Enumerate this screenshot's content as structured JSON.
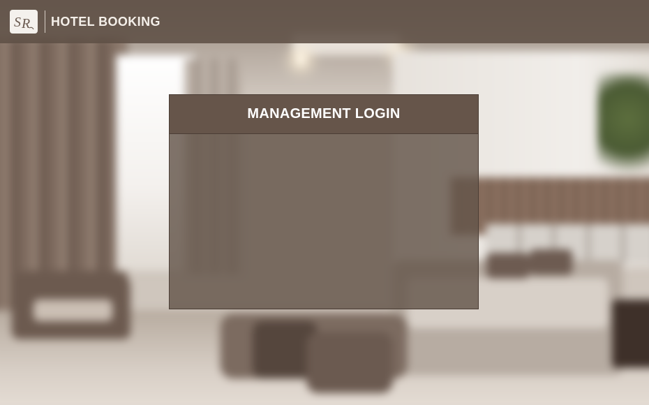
{
  "header": {
    "logo_text": "SR",
    "brand": "HOTEL BOOKING"
  },
  "login_panel": {
    "title": "MANAGEMENT LOGIN"
  },
  "colors": {
    "header_bg": "#5f5046",
    "panel_bg": "#64554b",
    "panel_head_bg": "#66554a",
    "text_light": "#ffffff"
  }
}
